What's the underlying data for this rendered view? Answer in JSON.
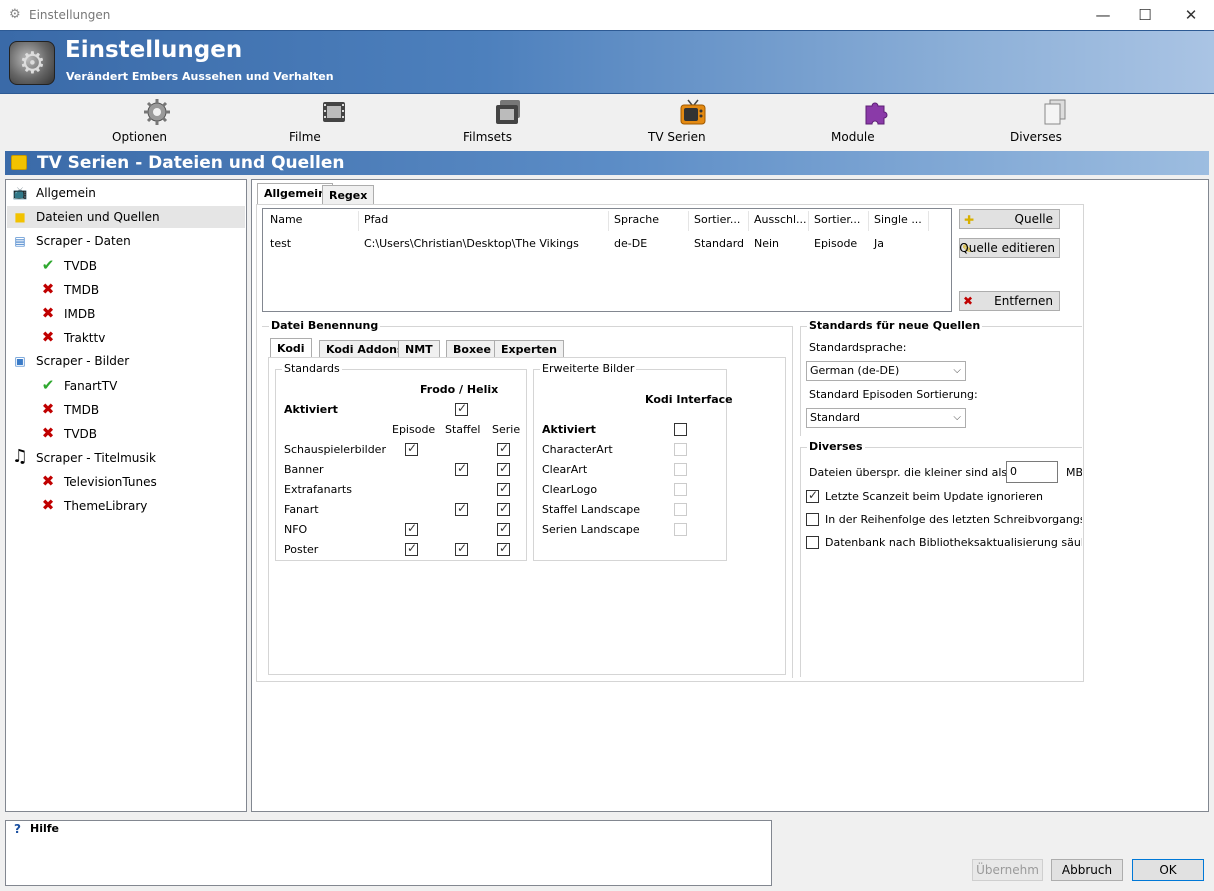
{
  "window": {
    "title": "Einstellungen"
  },
  "header": {
    "title": "Einstellungen",
    "subtitle": "Verändert Embers Aussehen und Verhalten"
  },
  "toolbar": {
    "items": [
      {
        "label": "Optionen"
      },
      {
        "label": "Filme"
      },
      {
        "label": "Filmsets"
      },
      {
        "label": "TV Serien"
      },
      {
        "label": "Module"
      },
      {
        "label": "Diverses"
      }
    ]
  },
  "section": {
    "title": "TV Serien - Dateien und Quellen"
  },
  "tree": {
    "items": [
      {
        "label": "Allgemein"
      },
      {
        "label": "Dateien und Quellen"
      },
      {
        "label": "Scraper - Daten"
      },
      {
        "label": "TVDB"
      },
      {
        "label": "TMDB"
      },
      {
        "label": "IMDB"
      },
      {
        "label": "Trakttv"
      },
      {
        "label": "Scraper - Bilder"
      },
      {
        "label": "FanartTV"
      },
      {
        "label": "TMDB"
      },
      {
        "label": "TVDB"
      },
      {
        "label": "Scraper - Titelmusik"
      },
      {
        "label": "TelevisionTunes"
      },
      {
        "label": "ThemeLibrary"
      }
    ]
  },
  "tabs": {
    "allgemein": "Allgemein",
    "regex": "Regex"
  },
  "sources": {
    "columns": [
      "Name",
      "Pfad",
      "Sprache",
      "Sortier...",
      "Ausschl...",
      "Sortier...",
      "Single ..."
    ],
    "rows": [
      [
        "test",
        "C:\\Users\\Christian\\Desktop\\The Vikings",
        "de-DE",
        "Standard",
        "Nein",
        "Episode",
        "Ja"
      ]
    ],
    "buttons": {
      "add": "Quelle",
      "edit": "Quelle editieren",
      "remove": "Entfernen"
    }
  },
  "naming": {
    "title": "Datei Benennung",
    "tabs": [
      "Kodi",
      "Kodi Addons",
      "NMT",
      "Boxee",
      "Experten"
    ],
    "standards": {
      "title": "Standards",
      "frodo": "Frodo / Helix",
      "activated": "Aktiviert",
      "cols": [
        "Episode",
        "Staffel",
        "Serie"
      ],
      "rows": [
        "Schauspielerbilder",
        "Banner",
        "Extrafanarts",
        "Fanart",
        "NFO",
        "Poster"
      ]
    },
    "extended": {
      "title": "Erweiterte Bilder",
      "kodi": "Kodi Interface",
      "activated": "Aktiviert",
      "rows": [
        "CharacterArt",
        "ClearArt",
        "ClearLogo",
        "Staffel Landscape",
        "Serien Landscape"
      ]
    }
  },
  "defaults": {
    "title": "Standards für neue Quellen",
    "lang_label": "Standardsprache:",
    "lang_value": "German (de-DE)",
    "sort_label": "Standard Episoden Sortierung:",
    "sort_value": "Standard"
  },
  "misc": {
    "title": "Diverses",
    "skip_label": "Dateien überspr. die kleiner sind als:",
    "skip_value": "0",
    "skip_unit": "MB",
    "opt1": "Letzte Scanzeit beim Update ignorieren",
    "opt2": "In der Reihenfolge des letzten Schreibvorgangs sc",
    "opt3": "Datenbank nach Bibliotheksaktualisierung säuber"
  },
  "help": {
    "title": "Hilfe"
  },
  "footer": {
    "apply": "Übernehm",
    "cancel": "Abbruch",
    "ok": "OK"
  }
}
